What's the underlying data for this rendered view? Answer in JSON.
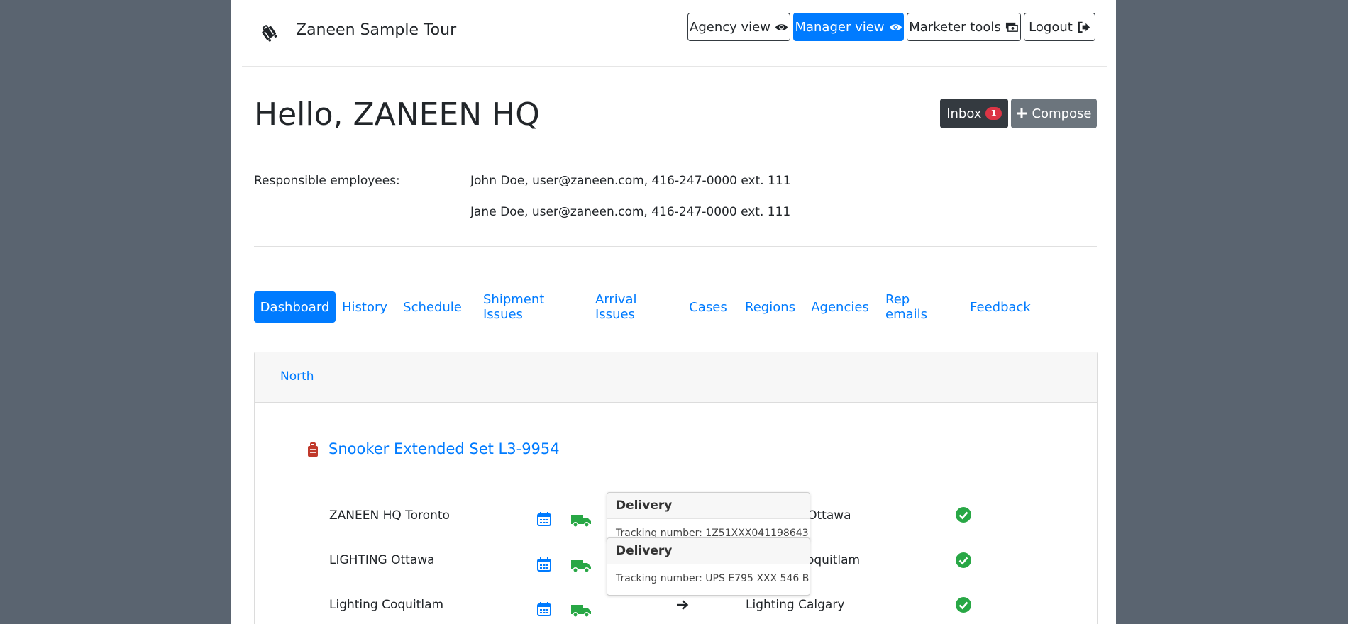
{
  "brand": {
    "name": "Zaneen Sample Tour",
    "icon": "suitcase-rolling-icon"
  },
  "header": {
    "buttons": [
      {
        "label": "Agency view",
        "icon": "eye-icon"
      },
      {
        "label": "Manager view",
        "icon": "eye-icon",
        "active": true
      },
      {
        "label": "Marketer tools",
        "icon": "money-bill-icon"
      },
      {
        "label": "Logout",
        "icon": "sign-out-icon"
      }
    ]
  },
  "greeting": "Hello, ZANEEN HQ",
  "inbox": {
    "label": "Inbox",
    "count": "1"
  },
  "compose": {
    "label": "Compose",
    "icon": "plus-icon"
  },
  "responsible": {
    "label": "Responsible employees:",
    "employees": [
      "John Doe, user@zaneen.com, 416-247-0000 ext. 111",
      "Jane Doe, user@zaneen.com, 416-247-0000 ext. 111"
    ]
  },
  "tabs": [
    "Dashboard",
    "History",
    "Schedule",
    "Shipment Issues",
    "Arrival Issues",
    "Cases",
    "Regions",
    "Agencies",
    "Rep emails",
    "Feedback"
  ],
  "card": {
    "tab": "North",
    "product": {
      "name": "Snooker Extended Set L3-9954",
      "icon": "suitcase-icon"
    },
    "rows": [
      {
        "from": "ZANEEN HQ Toronto",
        "to": "LIGHTING Ottawa"
      },
      {
        "from": "LIGHTING Ottawa",
        "to": "Lighting Coquitlam"
      },
      {
        "from": "Lighting Coquitlam",
        "to": "Lighting Calgary"
      }
    ],
    "popovers": [
      {
        "title": "Delivery",
        "text": "Tracking number: 1Z51XXX041198643"
      },
      {
        "title": "Delivery",
        "text": "Tracking number: UPS E795 XXX 546 B"
      }
    ]
  },
  "colors": {
    "primary": "#007bff",
    "dark": "#343a40",
    "secondary": "#6c757d",
    "success": "#28a745",
    "danger": "#dc3545",
    "backdrop": "#5a6470"
  }
}
